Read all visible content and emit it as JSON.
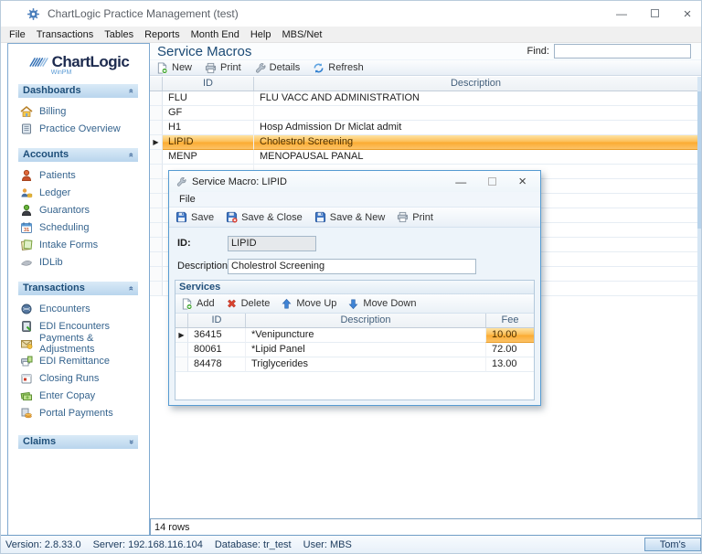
{
  "window": {
    "title": "ChartLogic Practice Management (test)"
  },
  "menu_bar": {
    "items": [
      "File",
      "Transactions",
      "Tables",
      "Reports",
      "Month End",
      "Help",
      "MBS/Net"
    ]
  },
  "page_header": {
    "title": "Service Macros",
    "find_label": "Find:",
    "find_value": ""
  },
  "sidebar": {
    "brand": "ChartLogic",
    "brand_sub": "WinPM",
    "sections": [
      {
        "label": "Dashboards",
        "collapsed": false,
        "items": [
          {
            "label": "Billing",
            "icon": "billing-icon"
          },
          {
            "label": "Practice Overview",
            "icon": "practice-overview-icon"
          }
        ]
      },
      {
        "label": "Accounts",
        "collapsed": false,
        "items": [
          {
            "label": "Patients",
            "icon": "patients-icon"
          },
          {
            "label": "Ledger",
            "icon": "ledger-icon"
          },
          {
            "label": "Guarantors",
            "icon": "guarantors-icon"
          },
          {
            "label": "Scheduling",
            "icon": "scheduling-icon"
          },
          {
            "label": "Intake Forms",
            "icon": "intake-forms-icon"
          },
          {
            "label": "IDLib",
            "icon": "idlib-icon"
          }
        ]
      },
      {
        "label": "Transactions",
        "collapsed": false,
        "items": [
          {
            "label": "Encounters",
            "icon": "encounters-icon"
          },
          {
            "label": "EDI Encounters",
            "icon": "edi-encounters-icon"
          },
          {
            "label": "Payments & Adjustments",
            "icon": "payments-icon"
          },
          {
            "label": "EDI Remittance",
            "icon": "edi-remittance-icon"
          },
          {
            "label": "Closing Runs",
            "icon": "closing-runs-icon"
          },
          {
            "label": "Enter Copay",
            "icon": "enter-copay-icon"
          },
          {
            "label": "Portal Payments",
            "icon": "portal-payments-icon"
          }
        ]
      },
      {
        "label": "Claims",
        "collapsed": true,
        "items": []
      }
    ]
  },
  "toolbar": {
    "new": "New",
    "print": "Print",
    "details": "Details",
    "refresh": "Refresh"
  },
  "main_grid": {
    "columns": {
      "id": "ID",
      "description": "Description"
    },
    "rows": [
      {
        "id": "FLU",
        "description": "FLU VACC AND ADMINISTRATION"
      },
      {
        "id": "GF",
        "description": ""
      },
      {
        "id": "H1",
        "description": "Hosp Admission Dr Miclat admit"
      },
      {
        "id": "LIPID",
        "description": "Cholestrol Screening"
      },
      {
        "id": "MENP",
        "description": "MENOPAUSAL PANAL"
      }
    ],
    "selected_row_index": 3,
    "footer": "14 rows"
  },
  "dialog": {
    "title": "Service Macro: LIPID",
    "menu": {
      "file": "File"
    },
    "toolbar": {
      "save": "Save",
      "save_close": "Save & Close",
      "save_new": "Save & New",
      "print": "Print"
    },
    "fields": {
      "id_label": "ID:",
      "id_value": "LIPID",
      "description_label": "Description:",
      "description_value": "Cholestrol Screening"
    },
    "services": {
      "title": "Services",
      "toolbar": {
        "add": "Add",
        "delete": "Delete",
        "move_up": "Move Up",
        "move_down": "Move Down"
      },
      "columns": {
        "id": "ID",
        "description": "Description",
        "fee": "Fee"
      },
      "rows": [
        {
          "id": "36415",
          "description": "*Venipuncture",
          "fee": "10.00"
        },
        {
          "id": "80061",
          "description": "*Lipid Panel",
          "fee": "72.00"
        },
        {
          "id": "84478",
          "description": "Triglycerides",
          "fee": "13.00"
        }
      ],
      "selected_row_index": 0
    }
  },
  "status_bar": {
    "version": "Version: 2.8.33.0",
    "server": "Server: 192.168.116.104",
    "database": "Database: tr_test",
    "user": "User: MBS",
    "profile": "Tom's"
  },
  "icons": {
    "selection_arrow": "▶",
    "chevron_collapse": "«",
    "close_glyph": "×",
    "minimize_glyph": "—"
  },
  "colors": {
    "accent_navy": "#1d4e79",
    "selection_orange": "#fbab31",
    "dialog_border": "#569bd2",
    "status_border": "#6f9dc6"
  }
}
